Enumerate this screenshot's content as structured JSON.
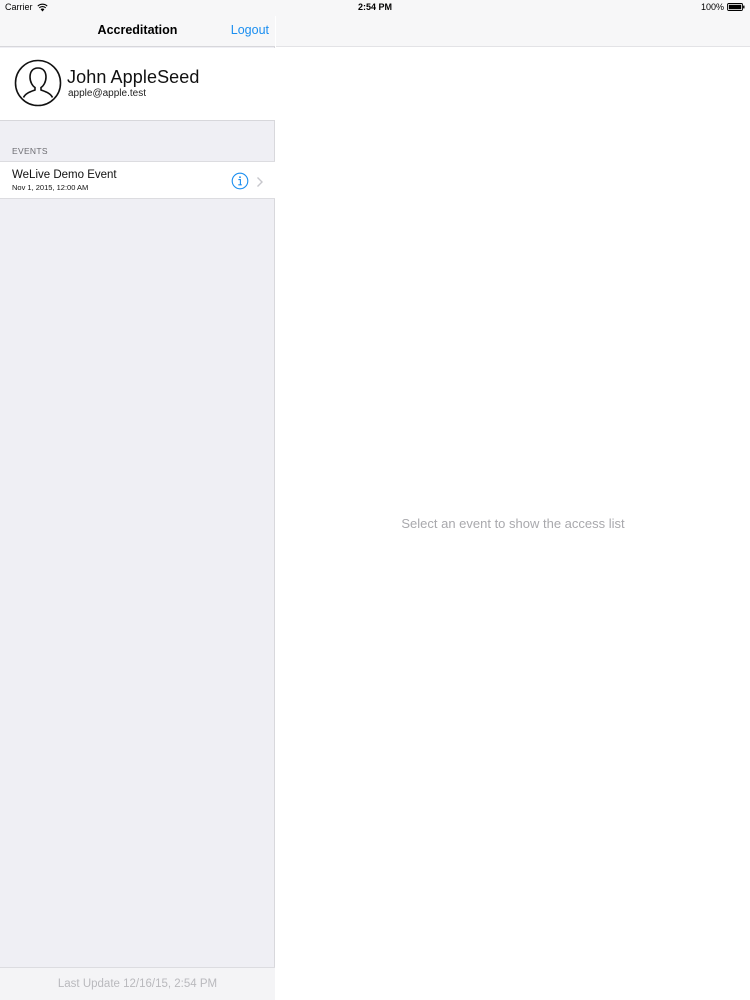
{
  "status_bar": {
    "carrier": "Carrier",
    "time": "2:54 PM",
    "battery": "100%"
  },
  "master": {
    "nav": {
      "title": "Accreditation",
      "logout_label": "Logout"
    },
    "user": {
      "name": "John  AppleSeed",
      "email": "apple@apple.test",
      "avatar_icon": "person-silhouette-icon"
    },
    "events_section": {
      "header": "EVENTS",
      "items": [
        {
          "title": "WeLive Demo Event",
          "date": "Nov 1, 2015, 12:00 AM",
          "accessory_icon": "info-icon",
          "disclosure_icon": "chevron-right-icon"
        }
      ]
    },
    "footer": {
      "last_update": "Last Update 12/16/15, 2:54 PM"
    }
  },
  "detail": {
    "empty_message": "Select an event to show the access list"
  },
  "colors": {
    "accent": "#1a8ef0",
    "grouped_background": "#efeff4",
    "secondary_text": "#a9a9ad"
  }
}
